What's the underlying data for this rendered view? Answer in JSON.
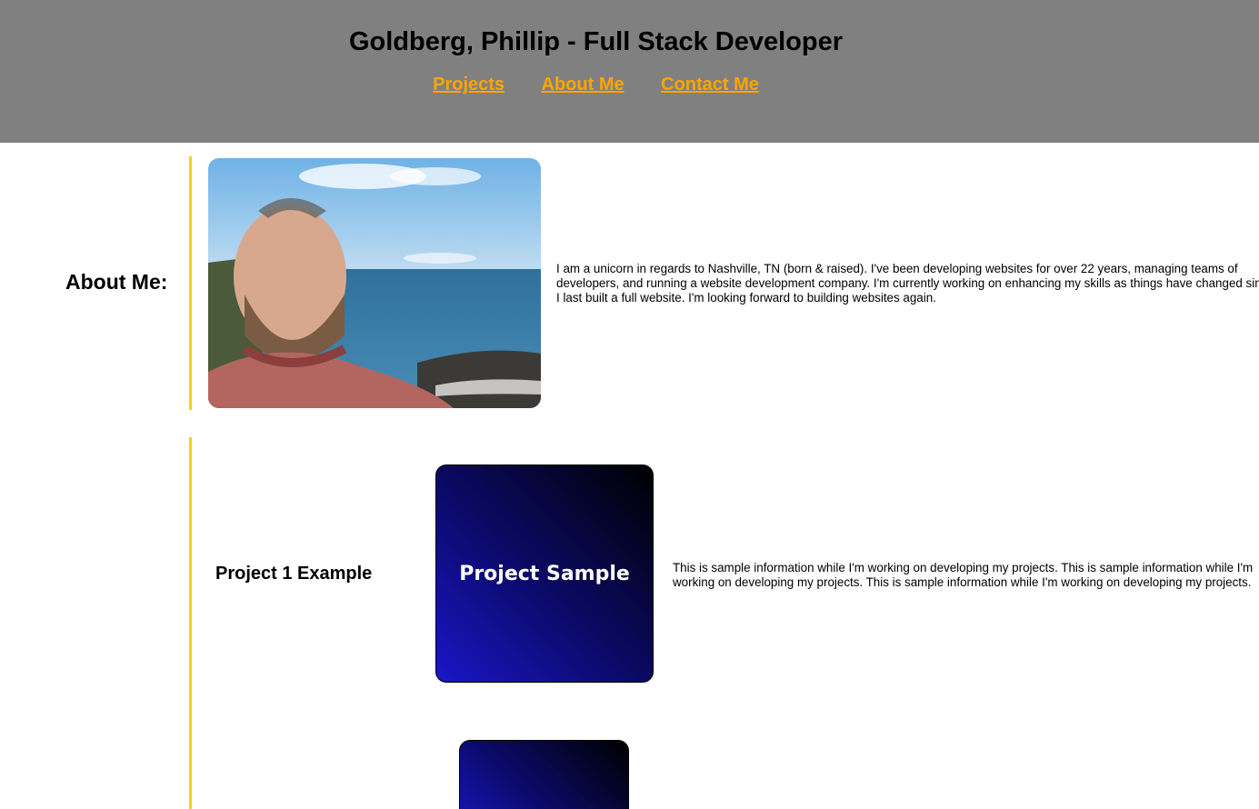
{
  "header": {
    "title": "Goldberg, Phillip - Full Stack Developer",
    "nav": [
      {
        "label": "Projects"
      },
      {
        "label": "About Me"
      },
      {
        "label": "Contact Me"
      }
    ],
    "background": "#808080",
    "link_color": "#ffa500"
  },
  "about": {
    "label": "About Me:",
    "text": "I am a unicorn in regards to Nashville, TN (born & raised). I've been developing websites for over 22 years, managing teams of developers, and running a website development company. I'm currently working on enhancing my skills as things have changed since I last built a full website. I'm looking forward to building websites again."
  },
  "projects": [
    {
      "title": "Project 1 Example",
      "image_label": "Project Sample",
      "description": "This is sample information while I'm working on developing my projects. This is sample information while I'm working on developing my projects. This is sample information while I'm working on developing my projects."
    }
  ],
  "accent_color": "#f2d600"
}
